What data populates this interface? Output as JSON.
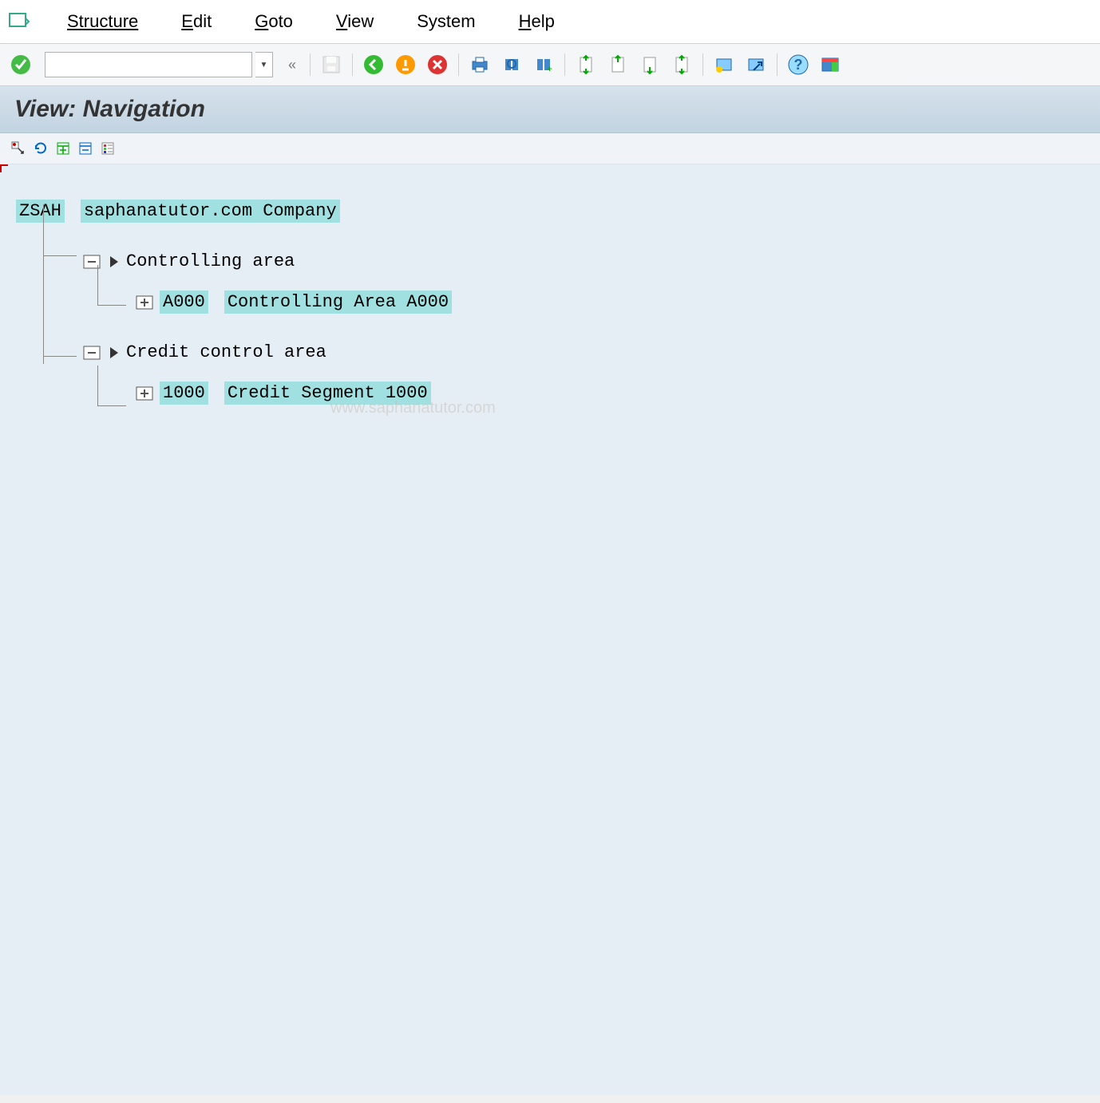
{
  "menu": {
    "structure": "Structure",
    "edit": "Edit",
    "goto": "Goto",
    "view": "View",
    "system": "System",
    "help": "Help"
  },
  "toolbar": {
    "tcode_value": "",
    "icons": {
      "enter": "enter",
      "save": "save",
      "back": "back",
      "exit": "exit",
      "cancel": "cancel",
      "print": "print",
      "find": "find",
      "find_next": "find-next",
      "first_page": "first-page",
      "prev_page": "prev-page",
      "next_page": "next-page",
      "last_page": "last-page",
      "new_session": "new-session",
      "shortcut": "shortcut",
      "help": "help",
      "layout": "layout"
    }
  },
  "title": "View: Navigation",
  "app_toolbar": {
    "icons": [
      "select",
      "refresh",
      "expand",
      "collapse",
      "legend"
    ]
  },
  "tree": {
    "root": {
      "code": "ZSAH",
      "desc": "saphanatutor.com Company"
    },
    "nodes": [
      {
        "label": "Controlling area",
        "child": {
          "code": "A000",
          "desc": "Controlling Area A000"
        }
      },
      {
        "label": "Credit control area",
        "child": {
          "code": "1000",
          "desc": "Credit Segment 1000"
        }
      }
    ]
  },
  "watermark": "www.saphanatutor.com"
}
